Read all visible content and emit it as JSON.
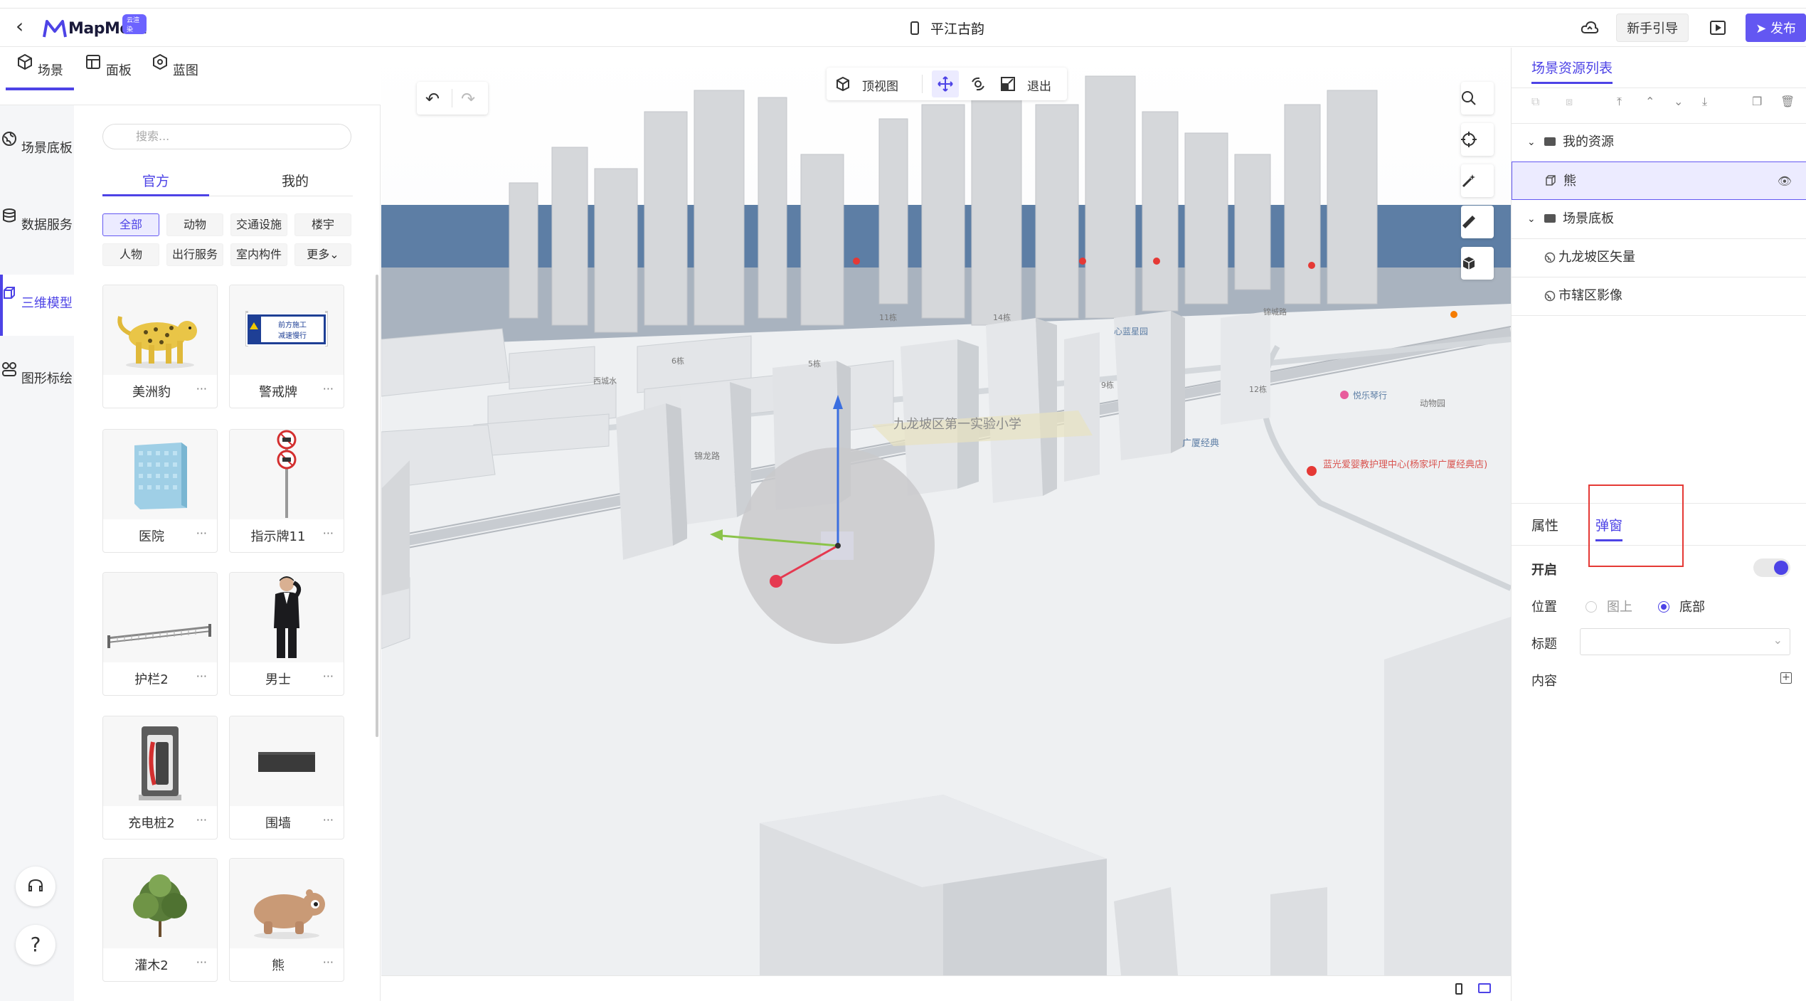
{
  "header": {
    "logo_text": "MapMost",
    "logo_badge": "云渲染",
    "title": "平江古韵",
    "guide_label": "新手引导",
    "publish_label": "发布"
  },
  "main_tabs": [
    {
      "label": "场景",
      "icon": "scene-icon",
      "active": true
    },
    {
      "label": "面板",
      "icon": "panel-icon",
      "active": false
    },
    {
      "label": "蓝图",
      "icon": "blueprint-icon",
      "active": false
    }
  ],
  "rail": [
    {
      "label": "场景底板",
      "icon": "globe-icon",
      "active": false
    },
    {
      "label": "数据服务",
      "icon": "database-icon",
      "active": false
    },
    {
      "label": "三维模型",
      "icon": "cube-icon",
      "active": true
    },
    {
      "label": "图形标绘",
      "icon": "shapes-icon",
      "active": false
    }
  ],
  "rail_bottom": {
    "help_label": "?"
  },
  "panel": {
    "search_placeholder": "搜索...",
    "tabs": [
      {
        "label": "官方",
        "active": true
      },
      {
        "label": "我的",
        "active": false
      }
    ],
    "chips": [
      {
        "label": "全部",
        "active": true
      },
      {
        "label": "动物",
        "active": false
      },
      {
        "label": "交通设施",
        "active": false
      },
      {
        "label": "楼宇",
        "active": false
      },
      {
        "label": "人物",
        "active": false
      },
      {
        "label": "出行服务",
        "active": false
      },
      {
        "label": "室内构件",
        "active": false
      },
      {
        "label": "更多",
        "active": false
      }
    ],
    "models": [
      {
        "name": "美洲豹"
      },
      {
        "name": "警戒牌",
        "sign_text": "前方施工 减速慢行"
      },
      {
        "name": "医院"
      },
      {
        "name": "指示牌11"
      },
      {
        "name": "护栏2"
      },
      {
        "name": "男士"
      },
      {
        "name": "充电桩2"
      },
      {
        "name": "围墙"
      },
      {
        "name": "灌木2"
      },
      {
        "name": "熊"
      }
    ],
    "more_dots": "···"
  },
  "viewport": {
    "toolbar": {
      "top_view_label": "顶视图",
      "exit_label": "退出"
    },
    "map_labels": [
      "九龙坡区第一实验小学",
      "锦龙路",
      "广厦经典",
      "蓝光爱婴教护理中心(杨家坪广厦经典店)",
      "悦乐琴行",
      "动物园",
      "心蓝星园",
      "14栋",
      "11栋",
      "6栋",
      "5栋",
      "9栋",
      "12栋",
      "西城水",
      "锦城路"
    ]
  },
  "right_panel": {
    "title": "场景资源列表",
    "tree": [
      {
        "label": "我的资源",
        "type": "folder",
        "depth": 0
      },
      {
        "label": "熊",
        "type": "model",
        "depth": 1,
        "selected": true
      },
      {
        "label": "场景底板",
        "type": "folder",
        "depth": 0
      },
      {
        "label": "九龙坡区矢量",
        "type": "layer",
        "depth": 1
      },
      {
        "label": "市辖区影像",
        "type": "layer",
        "depth": 1
      }
    ],
    "prop_tabs": [
      {
        "label": "属性",
        "active": false
      },
      {
        "label": "弹窗",
        "active": true
      }
    ],
    "props": {
      "enable_label": "开启",
      "enable_on": true,
      "position_label": "位置",
      "position_options": [
        {
          "label": "图上",
          "selected": false
        },
        {
          "label": "底部",
          "selected": true
        }
      ],
      "title_label": "标题",
      "title_value": "",
      "content_label": "内容"
    }
  },
  "colors": {
    "accent": "#4d43e6",
    "publish": "#6357f2",
    "highlight_box": "#e53935"
  }
}
